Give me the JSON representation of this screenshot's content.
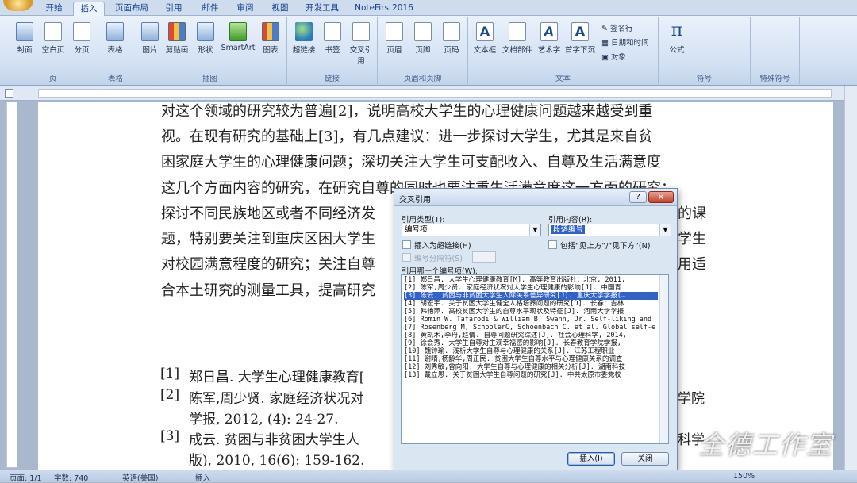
{
  "tabs": [
    "开始",
    "插入",
    "页面布局",
    "引用",
    "邮件",
    "审阅",
    "视图",
    "开发工具",
    "NoteFirst2016"
  ],
  "active_tab": "插入",
  "ribbon": {
    "groups": [
      {
        "label": "页",
        "buttons": [
          "封面",
          "空白页",
          "分页"
        ]
      },
      {
        "label": "表格",
        "buttons": [
          "表格"
        ]
      },
      {
        "label": "插图",
        "buttons": [
          "图片",
          "剪贴画",
          "形状",
          "SmartArt",
          "图表"
        ]
      },
      {
        "label": "链接",
        "buttons": [
          "超链接",
          "书签",
          "交叉引用"
        ]
      },
      {
        "label": "页眉和页脚",
        "buttons": [
          "页眉",
          "页脚",
          "页码"
        ]
      },
      {
        "label": "文本",
        "buttons": [
          "文本框",
          "文档部件",
          "艺术字",
          "首字下沉"
        ],
        "small": [
          "签名行",
          "日期和时间",
          "对象"
        ]
      },
      {
        "label": "符号",
        "buttons": [
          "公式"
        ]
      },
      {
        "label": "特殊符号",
        "buttons": []
      }
    ]
  },
  "document": {
    "paragraph_lines": [
      "对这个领域的研究较为普遍[2]，说明高校大学生的心理健康问题越来越受到重",
      "视。在现有研究的基础上[3]，有几点建议：进一步探讨大学生，尤其是来自贫",
      "困家庭大学生的心理健康问题；深切关注大学生可支配收入、自尊及生活满意度",
      "这几个方面内容的研究，在研究自尊的同时也要注重生活满意度这一方面的研究；",
      "探讨不同民族地区或者不同经济发",
      "题，特别要关注到重庆区困大学生",
      "对校园满意程度的研究；关注自尊",
      "合本土研究的测量工具，提高研究"
    ],
    "paragraph_right_fragments": [
      "的课",
      "学生",
      "用适"
    ],
    "references": [
      {
        "num": "[1]",
        "text": "郑日昌. 大学生心理健康教育[",
        "tail": ""
      },
      {
        "num": "[2]",
        "text": "陈军,周少贤. 家庭经济状况对",
        "tail": "学院"
      },
      {
        "num": "",
        "text": "学报, 2012, (4): 24-27.",
        "tail": ""
      },
      {
        "num": "[3]",
        "text": "成云. 贫困与非贫困大学生人",
        "tail": "科学"
      },
      {
        "num": "",
        "text": "版), 2010, 16(6): 159-162.",
        "tail": ""
      }
    ]
  },
  "dialog": {
    "title": "交叉引用",
    "help_label": "?",
    "close_label": "✕",
    "ref_type_label": "引用类型(T):",
    "ref_type_value": "编号项",
    "ref_content_label": "引用内容(R):",
    "ref_content_value": "段落编号",
    "insert_hyperlink_label": "插入为超链接(H)",
    "include_above_below_label": "包括“见上方”/“见下方”(N)",
    "separator_label": "编号分隔符(S)",
    "which_item_label": "引用哪一个编号项(W):",
    "items": [
      "[1] 郑日昌. 大学生心理健康教育[M]. 高等教育出版社：北京, 2011,",
      "[2] 陈军,周少贤. 家庭经济状况对大学生心理健康的影响[J]. 中国青",
      "[3] 陈云. 贫困与非贫困大学生人际关系差异研究[J]. 重庆大学学报(…",
      "[4] 胡宏宇. 关于贫困大学生健全人格培养问题的研究[D]. 长春：吉林",
      "[5] 韩艳萍. 高校贫困大学生的自尊水平现状及特征[J]. 河南大学学报",
      "[6] Romin W. Tafarodi & William B. Swann, Jr. Self-liking and",
      "[7] Rosenberg M, SchoolerC, Schoenbach C. et al. Global self-e",
      "[8] 黄凯木,李丹,赵倩. 自尊问题研究综述[J]. 社会心理科学, 2014,",
      "[9] 徐会秀. 大学生自尊对主观幸福感的影响[J]. 长春教育学院学报,",
      "[10] 魏钟瑜. 浅析大学生自尊与心理健康的关系[J]. 江苏工程职业",
      "[11] 谢晴,杨龄华,周正民. 贫困大学生自尊水平与心理健康关系的调查",
      "[12] 刘秀敏,曾向阳. 大学生自尊与心理健康的相关分析[J]. 湖南科技",
      "[13] 戴立恩. 关于贫困大学生自尊问题的研究[J]. 中共太原市委党校"
    ],
    "selected_index": 2,
    "insert_button": "插入(I)",
    "close_button": "关闭"
  },
  "status": {
    "page": "页面: 1/1",
    "words": "字数: 740",
    "language": "英语(美国)",
    "mode": "插入",
    "zoom": "150%"
  },
  "watermark": "全德工作室"
}
